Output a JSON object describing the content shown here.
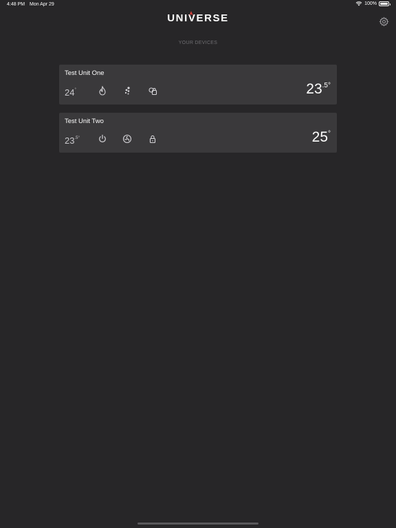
{
  "status_bar": {
    "time": "4:48 PM",
    "date": "Mon Apr 29",
    "battery": "100%"
  },
  "header": {
    "logo_text": "UNIVERSE",
    "subtitle": "YOUR DEVICES",
    "settings_icon": "gear-icon"
  },
  "devices": [
    {
      "name": "Test Unit One",
      "set_temp_whole": "24",
      "set_temp_fraction": "°",
      "room_temp_whole": "23",
      "room_temp_fraction": ".5°",
      "icons": [
        "flame-icon",
        "fan-dots-icon",
        "sensor-lock-icon"
      ]
    },
    {
      "name": "Test Unit Two",
      "set_temp_whole": "23",
      "set_temp_fraction": ".5°",
      "room_temp_whole": "25",
      "room_temp_fraction": "°",
      "icons": [
        "power-icon",
        "fan-speed-icon",
        "lock-icon"
      ]
    }
  ],
  "colors": {
    "background": "#272628",
    "card": "#3a393b",
    "logo_accent": "#d6403a",
    "muted_text": "#6f6e72"
  }
}
